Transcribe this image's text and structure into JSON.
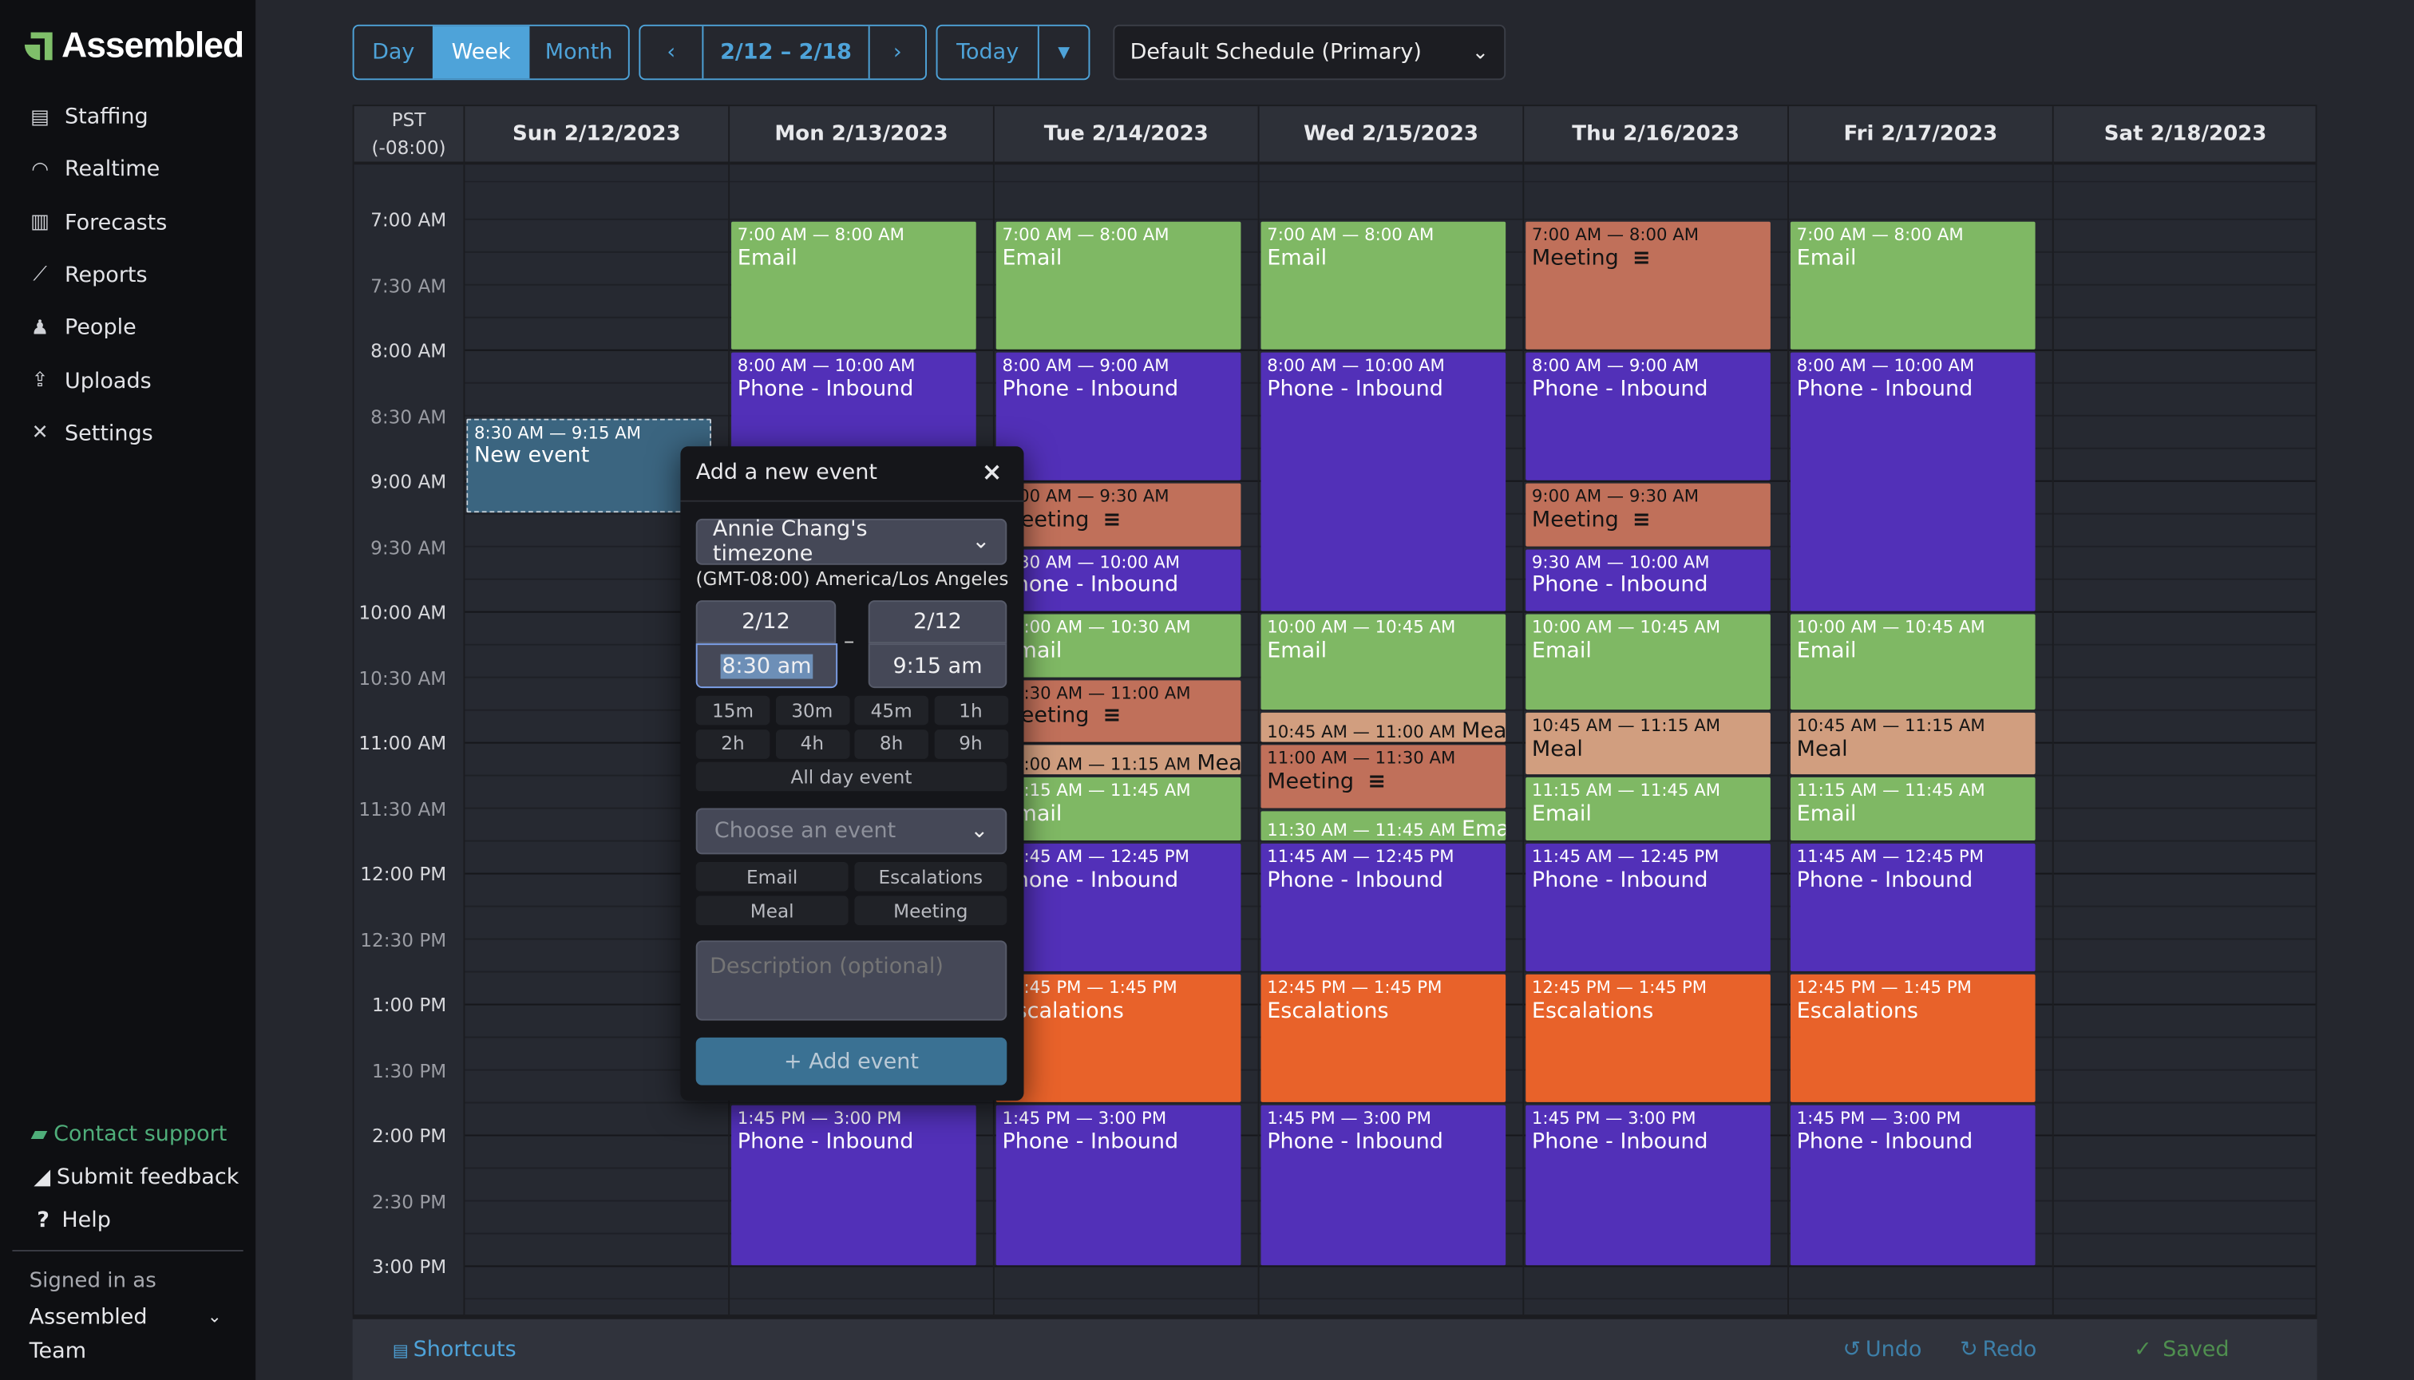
{
  "app": {
    "name": "Assembled",
    "brand_color": "#7fbf6a"
  },
  "sidebar": {
    "items": [
      {
        "label": "Staffing",
        "icon": "archive-icon"
      },
      {
        "label": "Realtime",
        "icon": "gauge-icon"
      },
      {
        "label": "Forecasts",
        "icon": "map-icon"
      },
      {
        "label": "Reports",
        "icon": "chart-line-icon"
      },
      {
        "label": "People",
        "icon": "people-icon"
      },
      {
        "label": "Uploads",
        "icon": "upload-icon"
      },
      {
        "label": "Settings",
        "icon": "tools-icon"
      }
    ],
    "contact_support": "Contact support",
    "submit_feedback": "Submit feedback",
    "help": "Help",
    "signed_in_as": "Signed in as",
    "user_line1": "Assembled",
    "user_line2": "Team"
  },
  "toolbar": {
    "views": [
      "Day",
      "Week",
      "Month"
    ],
    "active_view": "Week",
    "prev": "‹",
    "range": "2/12 – 2/18",
    "next": "›",
    "today": "Today",
    "schedule": "Default Schedule (Primary)",
    "accent": "#4ea3d9"
  },
  "calendar": {
    "tz_line1": "PST",
    "tz_line2": "(-08:00)",
    "days": [
      "Sun 2/12/2023",
      "Mon 2/13/2023",
      "Tue 2/14/2023",
      "Wed 2/15/2023",
      "Thu 2/16/2023",
      "Fri 2/17/2023",
      "Sat 2/18/2023"
    ],
    "times": [
      "7:00 AM",
      "7:30 AM",
      "8:00 AM",
      "8:30 AM",
      "9:00 AM",
      "9:30 AM",
      "10:00 AM",
      "10:30 AM",
      "11:00 AM",
      "11:30 AM",
      "12:00 PM",
      "12:30 PM",
      "1:00 PM",
      "1:30 PM",
      "2:00 PM",
      "2:30 PM",
      "3:00 PM"
    ],
    "colors": {
      "Email": "#7fb864",
      "Phone - Inbound": "#5230b8",
      "Meeting": "#c0705a",
      "Meal": "#d19e7f",
      "Escalations": "#e8622a"
    },
    "events": [
      {
        "day": 0,
        "start": 8.5,
        "end": 9.25,
        "time": "8:30 AM — 9:15 AM",
        "title": "New event",
        "new": true
      },
      {
        "day": 1,
        "start": 7,
        "end": 8,
        "time": "7:00 AM — 8:00 AM",
        "title": "Email"
      },
      {
        "day": 1,
        "start": 8,
        "end": 10,
        "time": "8:00 AM — 10:00 AM",
        "title": "Phone - Inbound"
      },
      {
        "day": 1,
        "start": 13.75,
        "end": 15,
        "time": "1:45 PM — 3:00 PM",
        "title": "Phone - Inbound"
      },
      {
        "day": 2,
        "start": 7,
        "end": 8,
        "time": "7:00 AM — 8:00 AM",
        "title": "Email"
      },
      {
        "day": 2,
        "start": 8,
        "end": 9,
        "time": "8:00 AM — 9:00 AM",
        "title": "Phone - Inbound"
      },
      {
        "day": 2,
        "start": 9,
        "end": 9.5,
        "time": "9:00 AM — 9:30 AM",
        "title": "Meeting",
        "notes": true
      },
      {
        "day": 2,
        "start": 9.5,
        "end": 10,
        "time": "9:30 AM — 10:00 AM",
        "title": "Phone - Inbound"
      },
      {
        "day": 2,
        "start": 10,
        "end": 10.5,
        "time": "10:00 AM — 10:30 AM",
        "title": "Email"
      },
      {
        "day": 2,
        "start": 10.5,
        "end": 11,
        "time": "10:30 AM — 11:00 AM",
        "title": "Meeting",
        "notes": true
      },
      {
        "day": 2,
        "start": 11,
        "end": 11.25,
        "time": "11:00 AM — 11:15 AM",
        "title": "Meal"
      },
      {
        "day": 2,
        "start": 11.25,
        "end": 11.75,
        "time": "11:15 AM — 11:45 AM",
        "title": "Email"
      },
      {
        "day": 2,
        "start": 11.75,
        "end": 12.75,
        "time": "11:45 AM — 12:45 PM",
        "title": "Phone - Inbound"
      },
      {
        "day": 2,
        "start": 12.75,
        "end": 13.75,
        "time": "12:45 PM — 1:45 PM",
        "title": "Escalations"
      },
      {
        "day": 2,
        "start": 13.75,
        "end": 15,
        "time": "1:45 PM — 3:00 PM",
        "title": "Phone - Inbound"
      },
      {
        "day": 3,
        "start": 7,
        "end": 8,
        "time": "7:00 AM — 8:00 AM",
        "title": "Email"
      },
      {
        "day": 3,
        "start": 8,
        "end": 10,
        "time": "8:00 AM — 10:00 AM",
        "title": "Phone - Inbound"
      },
      {
        "day": 3,
        "start": 10,
        "end": 10.75,
        "time": "10:00 AM — 10:45 AM",
        "title": "Email"
      },
      {
        "day": 3,
        "start": 10.75,
        "end": 11,
        "time": "10:45 AM — 11:00 AM",
        "title": "Meal"
      },
      {
        "day": 3,
        "start": 11,
        "end": 11.5,
        "time": "11:00 AM — 11:30 AM",
        "title": "Meeting",
        "notes": true
      },
      {
        "day": 3,
        "start": 11.5,
        "end": 11.75,
        "time": "11:30 AM — 11:45 AM",
        "title": "Email"
      },
      {
        "day": 3,
        "start": 11.75,
        "end": 12.75,
        "time": "11:45 AM — 12:45 PM",
        "title": "Phone - Inbound"
      },
      {
        "day": 3,
        "start": 12.75,
        "end": 13.75,
        "time": "12:45 PM — 1:45 PM",
        "title": "Escalations"
      },
      {
        "day": 3,
        "start": 13.75,
        "end": 15,
        "time": "1:45 PM — 3:00 PM",
        "title": "Phone - Inbound"
      },
      {
        "day": 4,
        "start": 7,
        "end": 8,
        "time": "7:00 AM — 8:00 AM",
        "title": "Meeting",
        "notes": true
      },
      {
        "day": 4,
        "start": 8,
        "end": 9,
        "time": "8:00 AM — 9:00 AM",
        "title": "Phone - Inbound"
      },
      {
        "day": 4,
        "start": 9,
        "end": 9.5,
        "time": "9:00 AM — 9:30 AM",
        "title": "Meeting",
        "notes": true
      },
      {
        "day": 4,
        "start": 9.5,
        "end": 10,
        "time": "9:30 AM — 10:00 AM",
        "title": "Phone - Inbound"
      },
      {
        "day": 4,
        "start": 10,
        "end": 10.75,
        "time": "10:00 AM — 10:45 AM",
        "title": "Email"
      },
      {
        "day": 4,
        "start": 10.75,
        "end": 11.25,
        "time": "10:45 AM — 11:15 AM",
        "title": "Meal"
      },
      {
        "day": 4,
        "start": 11.25,
        "end": 11.75,
        "time": "11:15 AM — 11:45 AM",
        "title": "Email"
      },
      {
        "day": 4,
        "start": 11.75,
        "end": 12.75,
        "time": "11:45 AM — 12:45 PM",
        "title": "Phone - Inbound"
      },
      {
        "day": 4,
        "start": 12.75,
        "end": 13.75,
        "time": "12:45 PM — 1:45 PM",
        "title": "Escalations"
      },
      {
        "day": 4,
        "start": 13.75,
        "end": 15,
        "time": "1:45 PM — 3:00 PM",
        "title": "Phone - Inbound"
      },
      {
        "day": 5,
        "start": 7,
        "end": 8,
        "time": "7:00 AM — 8:00 AM",
        "title": "Email"
      },
      {
        "day": 5,
        "start": 8,
        "end": 10,
        "time": "8:00 AM — 10:00 AM",
        "title": "Phone - Inbound"
      },
      {
        "day": 5,
        "start": 10,
        "end": 10.75,
        "time": "10:00 AM — 10:45 AM",
        "title": "Email"
      },
      {
        "day": 5,
        "start": 10.75,
        "end": 11.25,
        "time": "10:45 AM — 11:15 AM",
        "title": "Meal"
      },
      {
        "day": 5,
        "start": 11.25,
        "end": 11.75,
        "time": "11:15 AM — 11:45 AM",
        "title": "Email"
      },
      {
        "day": 5,
        "start": 11.75,
        "end": 12.75,
        "time": "11:45 AM — 12:45 PM",
        "title": "Phone - Inbound"
      },
      {
        "day": 5,
        "start": 12.75,
        "end": 13.75,
        "time": "12:45 PM — 1:45 PM",
        "title": "Escalations"
      },
      {
        "day": 5,
        "start": 13.75,
        "end": 15,
        "time": "1:45 PM — 3:00 PM",
        "title": "Phone - Inbound"
      }
    ]
  },
  "popup": {
    "title": "Add a new event",
    "close": "×",
    "timezone": "Annie Chang's timezone",
    "tz_detail": "(GMT-08:00) America/Los Angeles",
    "start_date": "2/12",
    "start_time": "8:30 am",
    "dash": "–",
    "end_date": "2/12",
    "end_time": "9:15 am",
    "durations": [
      "15m",
      "30m",
      "45m",
      "1h",
      "2h",
      "4h",
      "8h",
      "9h"
    ],
    "all_day": "All day event",
    "event_placeholder": "Choose an event",
    "event_types": [
      "Email",
      "Escalations",
      "Meal",
      "Meeting"
    ],
    "description_placeholder": "Description (optional)",
    "add_button": "+ Add event"
  },
  "footer": {
    "shortcuts": "Shortcuts",
    "undo": "Undo",
    "redo": "Redo",
    "saved": "Saved"
  }
}
